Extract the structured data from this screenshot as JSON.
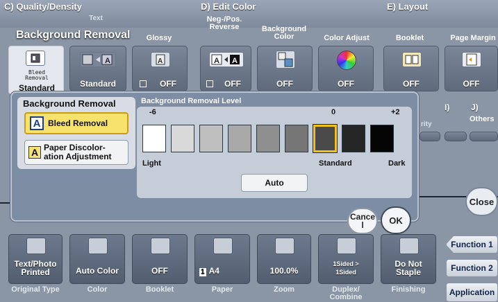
{
  "header": {
    "section_c": "C)  Quality/Density",
    "section_d": "D)  Edit Color",
    "section_e": "E)  Layout",
    "sub_text": "Text",
    "sub_background_removal": "Background Removal",
    "sub_glossy": "Glossy",
    "sub_negpos": "Neg-/Pos.\nReverse",
    "sub_bgcolor": "Background\nColor",
    "sub_coloradjust": "Color Adjust",
    "sub_booklet": "Booklet",
    "sub_pagemargin": "Page Margin",
    "val_text_standard": "Standard",
    "val_glossy": "OFF",
    "val_negpos": "OFF",
    "val_bgcolor": "OFF",
    "val_coloradjust": "OFF",
    "val_booklet": "OFF",
    "val_pagemargin": "OFF",
    "bg_tile_icon_label": "Bleed\nRemoval",
    "bg_tile_value": "Standard",
    "section_i": "I)",
    "section_j": "J)",
    "others": "Others",
    "frag_rity": "rity"
  },
  "dialog": {
    "left_title": "Background Removal",
    "option_bleed": "Bleed Removal",
    "option_paper": "Paper Discolor-\nation Adjustment",
    "option_letter": "A",
    "level_title": "Background Removal Level",
    "tick_min": "-6",
    "tick_zero": "0",
    "tick_max": "+2",
    "label_light": "Light",
    "label_standard": "Standard",
    "label_dark": "Dark",
    "auto": "Auto",
    "cancel": "Cance\nl",
    "ok": "OK",
    "levels": [
      "#ffffff",
      "#d9d9d9",
      "#bfbfbf",
      "#a8a8a8",
      "#8f8f8f",
      "#767676",
      "#4a4a4a",
      "#262626",
      "#050505"
    ],
    "selected_level": "0"
  },
  "bottom": {
    "tiles": [
      {
        "value": "Text/Photo\nPrinted",
        "label": "Original Type"
      },
      {
        "value": "Auto Color",
        "label": "Color"
      },
      {
        "value": "OFF",
        "label": "Booklet"
      },
      {
        "value": "A4",
        "label": "Paper",
        "badge": "1"
      },
      {
        "value": "100.0%",
        "label": "Zoom"
      },
      {
        "value": "1Sided >\n1Sided",
        "label": "Duplex/\nCombine"
      },
      {
        "value": "Do Not\nStaple",
        "label": "Finishing"
      }
    ]
  },
  "side": {
    "close": "Close",
    "function1": "Function 1",
    "function2": "Function 2",
    "application": "Application"
  }
}
